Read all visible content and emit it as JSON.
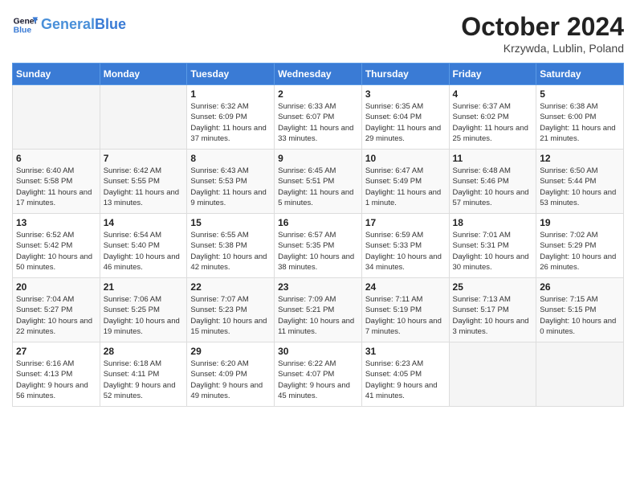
{
  "logo": {
    "line1": "General",
    "line2": "Blue"
  },
  "title": "October 2024",
  "subtitle": "Krzywda, Lublin, Poland",
  "days_of_week": [
    "Sunday",
    "Monday",
    "Tuesday",
    "Wednesday",
    "Thursday",
    "Friday",
    "Saturday"
  ],
  "weeks": [
    [
      {
        "day": "",
        "info": ""
      },
      {
        "day": "",
        "info": ""
      },
      {
        "day": "1",
        "info": "Sunrise: 6:32 AM\nSunset: 6:09 PM\nDaylight: 11 hours and 37 minutes."
      },
      {
        "day": "2",
        "info": "Sunrise: 6:33 AM\nSunset: 6:07 PM\nDaylight: 11 hours and 33 minutes."
      },
      {
        "day": "3",
        "info": "Sunrise: 6:35 AM\nSunset: 6:04 PM\nDaylight: 11 hours and 29 minutes."
      },
      {
        "day": "4",
        "info": "Sunrise: 6:37 AM\nSunset: 6:02 PM\nDaylight: 11 hours and 25 minutes."
      },
      {
        "day": "5",
        "info": "Sunrise: 6:38 AM\nSunset: 6:00 PM\nDaylight: 11 hours and 21 minutes."
      }
    ],
    [
      {
        "day": "6",
        "info": "Sunrise: 6:40 AM\nSunset: 5:58 PM\nDaylight: 11 hours and 17 minutes."
      },
      {
        "day": "7",
        "info": "Sunrise: 6:42 AM\nSunset: 5:55 PM\nDaylight: 11 hours and 13 minutes."
      },
      {
        "day": "8",
        "info": "Sunrise: 6:43 AM\nSunset: 5:53 PM\nDaylight: 11 hours and 9 minutes."
      },
      {
        "day": "9",
        "info": "Sunrise: 6:45 AM\nSunset: 5:51 PM\nDaylight: 11 hours and 5 minutes."
      },
      {
        "day": "10",
        "info": "Sunrise: 6:47 AM\nSunset: 5:49 PM\nDaylight: 11 hours and 1 minute."
      },
      {
        "day": "11",
        "info": "Sunrise: 6:48 AM\nSunset: 5:46 PM\nDaylight: 10 hours and 57 minutes."
      },
      {
        "day": "12",
        "info": "Sunrise: 6:50 AM\nSunset: 5:44 PM\nDaylight: 10 hours and 53 minutes."
      }
    ],
    [
      {
        "day": "13",
        "info": "Sunrise: 6:52 AM\nSunset: 5:42 PM\nDaylight: 10 hours and 50 minutes."
      },
      {
        "day": "14",
        "info": "Sunrise: 6:54 AM\nSunset: 5:40 PM\nDaylight: 10 hours and 46 minutes."
      },
      {
        "day": "15",
        "info": "Sunrise: 6:55 AM\nSunset: 5:38 PM\nDaylight: 10 hours and 42 minutes."
      },
      {
        "day": "16",
        "info": "Sunrise: 6:57 AM\nSunset: 5:35 PM\nDaylight: 10 hours and 38 minutes."
      },
      {
        "day": "17",
        "info": "Sunrise: 6:59 AM\nSunset: 5:33 PM\nDaylight: 10 hours and 34 minutes."
      },
      {
        "day": "18",
        "info": "Sunrise: 7:01 AM\nSunset: 5:31 PM\nDaylight: 10 hours and 30 minutes."
      },
      {
        "day": "19",
        "info": "Sunrise: 7:02 AM\nSunset: 5:29 PM\nDaylight: 10 hours and 26 minutes."
      }
    ],
    [
      {
        "day": "20",
        "info": "Sunrise: 7:04 AM\nSunset: 5:27 PM\nDaylight: 10 hours and 22 minutes."
      },
      {
        "day": "21",
        "info": "Sunrise: 7:06 AM\nSunset: 5:25 PM\nDaylight: 10 hours and 19 minutes."
      },
      {
        "day": "22",
        "info": "Sunrise: 7:07 AM\nSunset: 5:23 PM\nDaylight: 10 hours and 15 minutes."
      },
      {
        "day": "23",
        "info": "Sunrise: 7:09 AM\nSunset: 5:21 PM\nDaylight: 10 hours and 11 minutes."
      },
      {
        "day": "24",
        "info": "Sunrise: 7:11 AM\nSunset: 5:19 PM\nDaylight: 10 hours and 7 minutes."
      },
      {
        "day": "25",
        "info": "Sunrise: 7:13 AM\nSunset: 5:17 PM\nDaylight: 10 hours and 3 minutes."
      },
      {
        "day": "26",
        "info": "Sunrise: 7:15 AM\nSunset: 5:15 PM\nDaylight: 10 hours and 0 minutes."
      }
    ],
    [
      {
        "day": "27",
        "info": "Sunrise: 6:16 AM\nSunset: 4:13 PM\nDaylight: 9 hours and 56 minutes."
      },
      {
        "day": "28",
        "info": "Sunrise: 6:18 AM\nSunset: 4:11 PM\nDaylight: 9 hours and 52 minutes."
      },
      {
        "day": "29",
        "info": "Sunrise: 6:20 AM\nSunset: 4:09 PM\nDaylight: 9 hours and 49 minutes."
      },
      {
        "day": "30",
        "info": "Sunrise: 6:22 AM\nSunset: 4:07 PM\nDaylight: 9 hours and 45 minutes."
      },
      {
        "day": "31",
        "info": "Sunrise: 6:23 AM\nSunset: 4:05 PM\nDaylight: 9 hours and 41 minutes."
      },
      {
        "day": "",
        "info": ""
      },
      {
        "day": "",
        "info": ""
      }
    ]
  ]
}
